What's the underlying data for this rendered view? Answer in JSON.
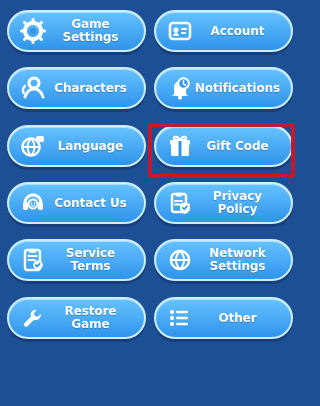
{
  "buttons": {
    "game_settings": {
      "label": "Game Settings",
      "icon": "gear-icon"
    },
    "account": {
      "label": "Account",
      "icon": "id-card-icon"
    },
    "characters": {
      "label": "Characters",
      "icon": "user-icon"
    },
    "notifications": {
      "label": "Notifications",
      "icon": "bell-icon"
    },
    "language": {
      "label": "Language",
      "icon": "globe-chat-icon"
    },
    "gift_code": {
      "label": "Gift Code",
      "icon": "gift-icon"
    },
    "contact_us": {
      "label": "Contact Us",
      "icon": "headset-icon"
    },
    "privacy_policy": {
      "label": "Privacy Policy",
      "icon": "shield-clipboard-icon"
    },
    "service_terms": {
      "label": "Service Terms",
      "icon": "document-check-icon"
    },
    "network_settings": {
      "label": "Network\nSettings",
      "icon": "globe-icon"
    },
    "restore_game": {
      "label": "Restore Game",
      "icon": "wrench-icon"
    },
    "other": {
      "label": "Other",
      "icon": "list-icon"
    }
  },
  "colors": {
    "background": "#1d4f95",
    "button_fill": "#2f94eb",
    "button_highlight": "#cdeeff",
    "selection_border": "#c8172c"
  }
}
